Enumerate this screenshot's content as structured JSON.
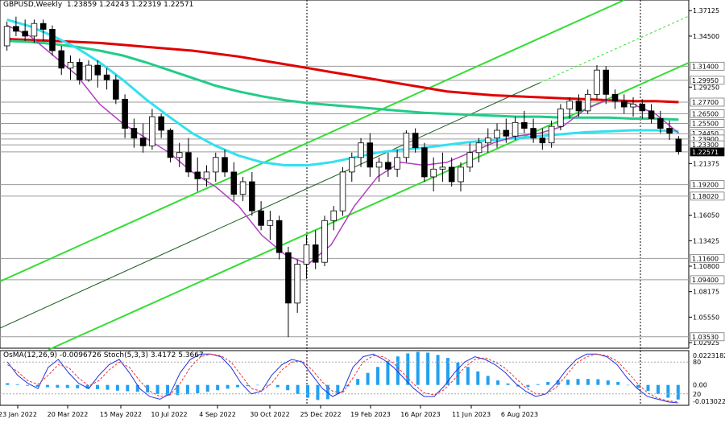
{
  "header": {
    "symbol": "GBPUSD,Weekly",
    "ohlc": "1.23859 1.24243 1.22319 1.22571",
    "indicators": "OsMA(12,26,9) -0.0096726  Stoch(5,3,3) 3.4172 5.3667"
  },
  "colors": {
    "bull": "#ffffff",
    "bear": "#000000",
    "ema_red": "#e00000",
    "ema_green": "#22cc88",
    "ema_cyan": "#33e0f0",
    "ema_purple": "#b040c0",
    "channel": "#33dd33",
    "stoch_main": "#2233dd",
    "stoch_signal": "#ee3333",
    "osma": "#22a0f0"
  },
  "chart_data": {
    "type": "candlestick",
    "symbol": "GBPUSD",
    "timeframe": "Weekly",
    "last_price": 1.22571,
    "x_tick_labels": [
      "23 Jan 2022",
      "20 Mar 2022",
      "15 May 2022",
      "10 Jul 2022",
      "4 Sep 2022",
      "30 Oct 2022",
      "25 Dec 2022",
      "19 Feb 2023",
      "16 Apr 2023",
      "11 Jun 2023",
      "6 Aug 2023"
    ],
    "y_tick_labels": [
      "1.37125",
      "1.34500",
      "1.29250",
      "1.21375",
      "1.16050",
      "1.13425",
      "1.10800",
      "1.08175",
      "1.05550",
      "1.02925"
    ],
    "ylim": [
      1.0235,
      1.3822
    ],
    "level_labels": [
      "1.31400",
      "1.29950",
      "1.27700",
      "1.26500",
      "1.25500",
      "1.24450",
      "1.23900",
      "1.23300",
      "1.22571",
      "1.19200",
      "1.18020",
      "1.11600",
      "1.09400",
      "1.03530"
    ],
    "candles": [
      [
        1.335,
        1.36,
        1.33,
        1.355
      ],
      [
        1.355,
        1.365,
        1.345,
        1.35
      ],
      [
        1.35,
        1.362,
        1.34,
        1.345
      ],
      [
        1.345,
        1.362,
        1.338,
        1.358
      ],
      [
        1.358,
        1.362,
        1.34,
        1.352
      ],
      [
        1.352,
        1.356,
        1.325,
        1.33
      ],
      [
        1.33,
        1.335,
        1.305,
        1.312
      ],
      [
        1.312,
        1.325,
        1.3,
        1.318
      ],
      [
        1.318,
        1.322,
        1.295,
        1.3
      ],
      [
        1.3,
        1.32,
        1.298,
        1.315
      ],
      [
        1.315,
        1.32,
        1.292,
        1.305
      ],
      [
        1.305,
        1.312,
        1.29,
        1.3
      ],
      [
        1.3,
        1.305,
        1.275,
        1.28
      ],
      [
        1.28,
        1.285,
        1.24,
        1.25
      ],
      [
        1.25,
        1.26,
        1.23,
        1.24
      ],
      [
        1.24,
        1.255,
        1.225,
        1.232
      ],
      [
        1.232,
        1.27,
        1.228,
        1.262
      ],
      [
        1.262,
        1.265,
        1.24,
        1.248
      ],
      [
        1.248,
        1.25,
        1.215,
        1.22
      ],
      [
        1.22,
        1.235,
        1.21,
        1.225
      ],
      [
        1.225,
        1.24,
        1.2,
        1.205
      ],
      [
        1.205,
        1.22,
        1.185,
        1.198
      ],
      [
        1.198,
        1.212,
        1.19,
        1.205
      ],
      [
        1.205,
        1.225,
        1.195,
        1.22
      ],
      [
        1.22,
        1.228,
        1.2,
        1.205
      ],
      [
        1.205,
        1.215,
        1.175,
        1.182
      ],
      [
        1.182,
        1.2,
        1.175,
        1.195
      ],
      [
        1.195,
        1.205,
        1.16,
        1.165
      ],
      [
        1.165,
        1.175,
        1.145,
        1.15
      ],
      [
        1.15,
        1.165,
        1.135,
        1.155
      ],
      [
        1.155,
        1.16,
        1.115,
        1.122
      ],
      [
        1.122,
        1.128,
        1.035,
        1.07
      ],
      [
        1.07,
        1.115,
        1.06,
        1.11
      ],
      [
        1.11,
        1.14,
        1.095,
        1.13
      ],
      [
        1.13,
        1.145,
        1.105,
        1.112
      ],
      [
        1.112,
        1.16,
        1.108,
        1.155
      ],
      [
        1.155,
        1.17,
        1.145,
        1.165
      ],
      [
        1.165,
        1.21,
        1.16,
        1.205
      ],
      [
        1.205,
        1.225,
        1.195,
        1.22
      ],
      [
        1.22,
        1.24,
        1.21,
        1.235
      ],
      [
        1.235,
        1.245,
        1.2,
        1.21
      ],
      [
        1.21,
        1.22,
        1.195,
        1.215
      ],
      [
        1.215,
        1.225,
        1.2,
        1.208
      ],
      [
        1.208,
        1.228,
        1.2,
        1.22
      ],
      [
        1.22,
        1.248,
        1.215,
        1.245
      ],
      [
        1.245,
        1.25,
        1.225,
        1.23
      ],
      [
        1.23,
        1.235,
        1.195,
        1.2
      ],
      [
        1.2,
        1.22,
        1.185,
        1.208
      ],
      [
        1.208,
        1.225,
        1.195,
        1.21
      ],
      [
        1.21,
        1.22,
        1.19,
        1.195
      ],
      [
        1.195,
        1.215,
        1.185,
        1.21
      ],
      [
        1.21,
        1.235,
        1.205,
        1.225
      ],
      [
        1.225,
        1.24,
        1.215,
        1.235
      ],
      [
        1.235,
        1.25,
        1.225,
        1.24
      ],
      [
        1.24,
        1.255,
        1.23,
        1.248
      ],
      [
        1.248,
        1.26,
        1.235,
        1.242
      ],
      [
        1.242,
        1.262,
        1.238,
        1.256
      ],
      [
        1.256,
        1.268,
        1.245,
        1.25
      ],
      [
        1.25,
        1.26,
        1.235,
        1.24
      ],
      [
        1.24,
        1.25,
        1.228,
        1.235
      ],
      [
        1.235,
        1.258,
        1.23,
        1.252
      ],
      [
        1.252,
        1.275,
        1.248,
        1.27
      ],
      [
        1.27,
        1.282,
        1.26,
        1.278
      ],
      [
        1.278,
        1.285,
        1.262,
        1.268
      ],
      [
        1.268,
        1.29,
        1.265,
        1.285
      ],
      [
        1.285,
        1.315,
        1.28,
        1.31
      ],
      [
        1.31,
        1.314,
        1.275,
        1.285
      ],
      [
        1.285,
        1.29,
        1.27,
        1.278
      ],
      [
        1.278,
        1.285,
        1.265,
        1.272
      ],
      [
        1.272,
        1.282,
        1.262,
        1.275
      ],
      [
        1.275,
        1.28,
        1.26,
        1.268
      ],
      [
        1.268,
        1.275,
        1.255,
        1.26
      ],
      [
        1.26,
        1.268,
        1.245,
        1.25
      ],
      [
        1.25,
        1.258,
        1.238,
        1.245
      ],
      [
        1.239,
        1.242,
        1.223,
        1.226
      ]
    ],
    "ema_red": [
      1.342,
      1.341,
      1.34,
      1.339,
      1.338,
      1.336,
      1.334,
      1.332,
      1.33,
      1.327,
      1.324,
      1.32,
      1.316,
      1.312,
      1.308,
      1.304,
      1.3,
      1.296,
      1.292,
      1.288,
      1.286,
      1.284,
      1.283,
      1.282,
      1.281,
      1.28,
      1.279,
      1.278,
      1.278,
      1.277
    ],
    "ema_green": [
      1.34,
      1.339,
      1.337,
      1.334,
      1.33,
      1.325,
      1.318,
      1.31,
      1.302,
      1.294,
      1.288,
      1.283,
      1.279,
      1.276,
      1.274,
      1.272,
      1.27,
      1.268,
      1.266,
      1.265,
      1.264,
      1.263,
      1.262,
      1.262,
      1.261,
      1.261,
      1.261,
      1.26,
      1.26,
      1.259
    ],
    "ema_cyan": [
      1.362,
      1.355,
      1.345,
      1.333,
      1.318,
      1.3,
      1.28,
      1.262,
      1.245,
      1.232,
      1.222,
      1.215,
      1.212,
      1.212,
      1.215,
      1.22,
      1.225,
      1.228,
      1.23,
      1.233,
      1.236,
      1.238,
      1.24,
      1.242,
      1.244,
      1.246,
      1.247,
      1.248,
      1.248,
      1.247
    ],
    "ema_purple": [
      1.356,
      1.345,
      1.325,
      1.305,
      1.275,
      1.255,
      1.24,
      1.225,
      1.205,
      1.19,
      1.17,
      1.14,
      1.12,
      1.11,
      1.13,
      1.17,
      1.2,
      1.215,
      1.212,
      1.215,
      1.225,
      1.235,
      1.242,
      1.245,
      1.252,
      1.27,
      1.28,
      1.275,
      1.265,
      1.245
    ],
    "stoch_main": [
      80,
      55,
      40,
      30,
      70,
      85,
      60,
      40,
      30,
      55,
      75,
      85,
      60,
      30,
      15,
      10,
      20,
      60,
      85,
      95,
      95,
      90,
      70,
      40,
      20,
      25,
      55,
      75,
      85,
      80,
      55,
      30,
      15,
      25,
      70,
      90,
      95,
      85,
      70,
      50,
      30,
      15,
      15,
      35,
      60,
      80,
      90,
      85,
      75,
      60,
      40,
      25,
      15,
      20,
      40,
      65,
      85,
      95,
      95,
      90,
      75,
      50,
      30,
      15,
      10,
      5,
      3
    ],
    "stoch_signal": [
      75,
      62,
      45,
      38,
      55,
      75,
      70,
      50,
      35,
      45,
      65,
      80,
      70,
      45,
      25,
      15,
      18,
      40,
      70,
      90,
      95,
      92,
      80,
      55,
      30,
      25,
      40,
      65,
      80,
      82,
      65,
      42,
      25,
      22,
      50,
      80,
      92,
      90,
      78,
      58,
      38,
      22,
      18,
      28,
      48,
      70,
      85,
      88,
      80,
      68,
      50,
      32,
      20,
      20,
      32,
      55,
      78,
      90,
      95,
      92,
      82,
      62,
      40,
      22,
      12,
      7,
      5
    ],
    "osma": [
      0.0012,
      0.0005,
      -0.0005,
      -0.0012,
      -0.0015,
      -0.0018,
      -0.002,
      -0.0022,
      -0.0025,
      -0.0028,
      -0.0032,
      -0.0038,
      -0.0042,
      -0.0045,
      -0.005,
      -0.006,
      -0.007,
      -0.0068,
      -0.0062,
      -0.0055,
      -0.0045,
      -0.0035,
      -0.0025,
      -0.0015,
      -0.0008,
      0.0,
      -0.0005,
      -0.0015,
      -0.0035,
      -0.006,
      -0.0085,
      -0.01,
      -0.0095,
      -0.006,
      -0.001,
      0.004,
      0.008,
      0.012,
      0.016,
      0.019,
      0.021,
      0.022,
      0.0215,
      0.02,
      0.018,
      0.015,
      0.012,
      0.009,
      0.006,
      0.003,
      0.001,
      -0.001,
      -0.0015,
      0.0005,
      0.002,
      0.003,
      0.0035,
      0.004,
      0.004,
      0.0038,
      0.003,
      0.002,
      0.0,
      -0.002,
      -0.004,
      -0.006,
      -0.0085,
      -0.0097
    ],
    "osma_labels": [
      "0.0223182",
      "0.00",
      "-0.013022"
    ],
    "stoch_labels": [
      "80",
      "20"
    ]
  }
}
